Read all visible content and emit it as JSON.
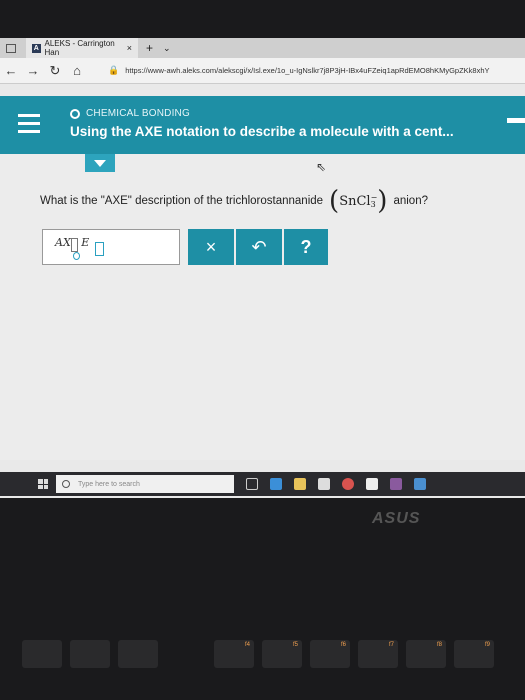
{
  "browser": {
    "tab_title": "ALEKS - Carrington Han",
    "tab_close": "×",
    "new_tab": "+",
    "tab_menu": "⌄",
    "url": "https://www-awh.aleks.com/alekscgi/x/Isl.exe/1o_u-IgNslkr7j8P3jH-IBx4uFZeiq1apRdEMO8hKMyGpZKk8xhY"
  },
  "header": {
    "topic": "CHEMICAL BONDING",
    "title": "Using the AXE notation to describe a molecule with a cent..."
  },
  "question": {
    "prefix": "What is the \"AXE\" description of the trichlorostannanide",
    "formula_main": "SnCl",
    "formula_sub": "3",
    "formula_sup": "−",
    "suffix": "anion?"
  },
  "answer": {
    "template_a": "A",
    "template_x": "X",
    "template_e": "E"
  },
  "tools": {
    "clear": "×",
    "undo": "↶",
    "help": "?"
  },
  "taskbar": {
    "search_placeholder": "Type here to search"
  },
  "laptop": {
    "brand": "ASUS"
  },
  "keys": {
    "f4": "f4",
    "f5": "f5",
    "f6": "f6",
    "f7": "f7",
    "f8": "f8",
    "f9": "f9"
  },
  "colors": {
    "accent": "#1e8fa5",
    "accent_light": "#2da4bd"
  }
}
